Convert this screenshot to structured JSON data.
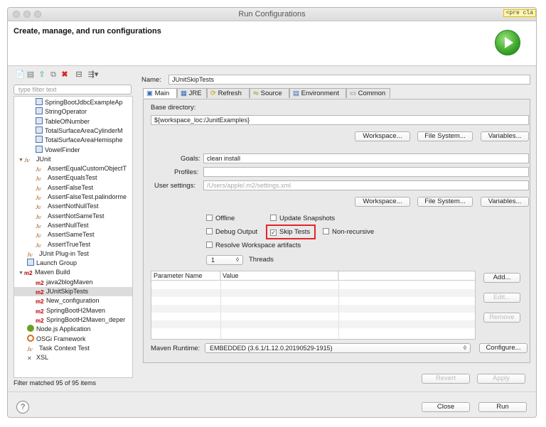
{
  "window": {
    "title": "Run Configurations",
    "pre_tag": "<pre cla"
  },
  "header": {
    "title": "Create, manage, and run configurations"
  },
  "left": {
    "toolbar_icons": [
      "new-config-icon",
      "new-prototype-icon",
      "export-icon",
      "duplicate-icon",
      "delete-icon",
      "collapse-all-icon",
      "filter-icon"
    ],
    "filter_placeholder": "type filter text",
    "tree": [
      {
        "label": "SpringBootJdbcExampleAp",
        "icon": "t",
        "indent": 2
      },
      {
        "label": "StringOperator",
        "icon": "t",
        "indent": 2
      },
      {
        "label": "TableOfNumber",
        "icon": "t",
        "indent": 2
      },
      {
        "label": "TotalSurfaceAreaCylinderM",
        "icon": "t",
        "indent": 2
      },
      {
        "label": "TotalSurfaceAreaHemisphe",
        "icon": "t",
        "indent": 2
      },
      {
        "label": "VowelFinder",
        "icon": "t",
        "indent": 2
      },
      {
        "label": "JUnit",
        "icon": "ju",
        "indent": 0,
        "arrow": "▼"
      },
      {
        "label": "AssertEqualCustomObjectT",
        "icon": "ju",
        "indent": 2
      },
      {
        "label": "AssertEqualsTest",
        "icon": "ju",
        "indent": 2
      },
      {
        "label": "AssertFalseTest",
        "icon": "ju",
        "indent": 2
      },
      {
        "label": "AssertFalseTest.palindorme",
        "icon": "ju",
        "indent": 2
      },
      {
        "label": "AssertNotNullTest",
        "icon": "ju",
        "indent": 2
      },
      {
        "label": "AssertNotSameTest",
        "icon": "ju",
        "indent": 2
      },
      {
        "label": "AssertNullTest",
        "icon": "ju",
        "indent": 2
      },
      {
        "label": "AssertSameTest",
        "icon": "ju",
        "indent": 2
      },
      {
        "label": "AssertTrueTest",
        "icon": "ju",
        "indent": 2
      },
      {
        "label": "JUnit Plug-in Test",
        "icon": "ju",
        "indent": 1
      },
      {
        "label": "Launch Group",
        "icon": "t",
        "indent": 1
      },
      {
        "label": "Maven Build",
        "icon": "m2",
        "indent": 0,
        "arrow": "▼"
      },
      {
        "label": "java2blogMaven",
        "icon": "m2",
        "indent": 2
      },
      {
        "label": "JUnitSkipTests",
        "icon": "m2",
        "indent": 2,
        "selected": true
      },
      {
        "label": "New_configuration",
        "icon": "m2",
        "indent": 2
      },
      {
        "label": "SpringBootH2Maven",
        "icon": "m2",
        "indent": 2
      },
      {
        "label": "SpringBootH2Maven_deper",
        "icon": "m2",
        "indent": 2
      },
      {
        "label": "Node.js Application",
        "icon": "node",
        "indent": 1
      },
      {
        "label": "OSGi Framework",
        "icon": "osgi",
        "indent": 1
      },
      {
        "label": "Task Context Test",
        "icon": "ju",
        "indent": 1
      },
      {
        "label": "XSL",
        "icon": "xsl",
        "indent": 1
      }
    ],
    "status": "Filter matched 95 of 95 items"
  },
  "right": {
    "name_label": "Name:",
    "name_value": "JUnitSkipTests",
    "tabs": [
      "Main",
      "JRE",
      "Refresh",
      "Source",
      "Environment",
      "Common"
    ],
    "base_dir_label": "Base directory:",
    "base_dir_value": "${workspace_loc:/JunitExamples}",
    "buttons1": [
      "Workspace...",
      "File System...",
      "Variables..."
    ],
    "goals_label": "Goals:",
    "goals_value": "clean install",
    "profiles_label": "Profiles:",
    "profiles_value": "",
    "settings_label": "User settings:",
    "settings_placeholder": "/Users/apple/.m2/settings.xml",
    "buttons2": [
      "Workspace...",
      "File System...",
      "Variables..."
    ],
    "checkboxes": {
      "offline": {
        "label": "Offline",
        "checked": false
      },
      "update_snapshots": {
        "label": "Update Snapshots",
        "checked": false
      },
      "debug_output": {
        "label": "Debug Output",
        "checked": false
      },
      "skip_tests": {
        "label": "Skip Tests",
        "checked": true
      },
      "non_recursive": {
        "label": "Non-recursive",
        "checked": false
      },
      "resolve_workspace": {
        "label": "Resolve Workspace artifacts",
        "checked": false
      }
    },
    "threads_value": "1",
    "threads_label": "Threads",
    "table_headers": [
      "Parameter Name",
      "Value"
    ],
    "table_buttons": [
      "Add...",
      "Edit...",
      "Remove"
    ],
    "runtime_label": "Maven Runtime:",
    "runtime_value": "EMBEDDED (3.6.1/1.12.0.20190529-1915)",
    "configure_label": "Configure...",
    "revert_label": "Revert",
    "apply_label": "Apply"
  },
  "footer": {
    "close_label": "Close",
    "run_label": "Run"
  }
}
